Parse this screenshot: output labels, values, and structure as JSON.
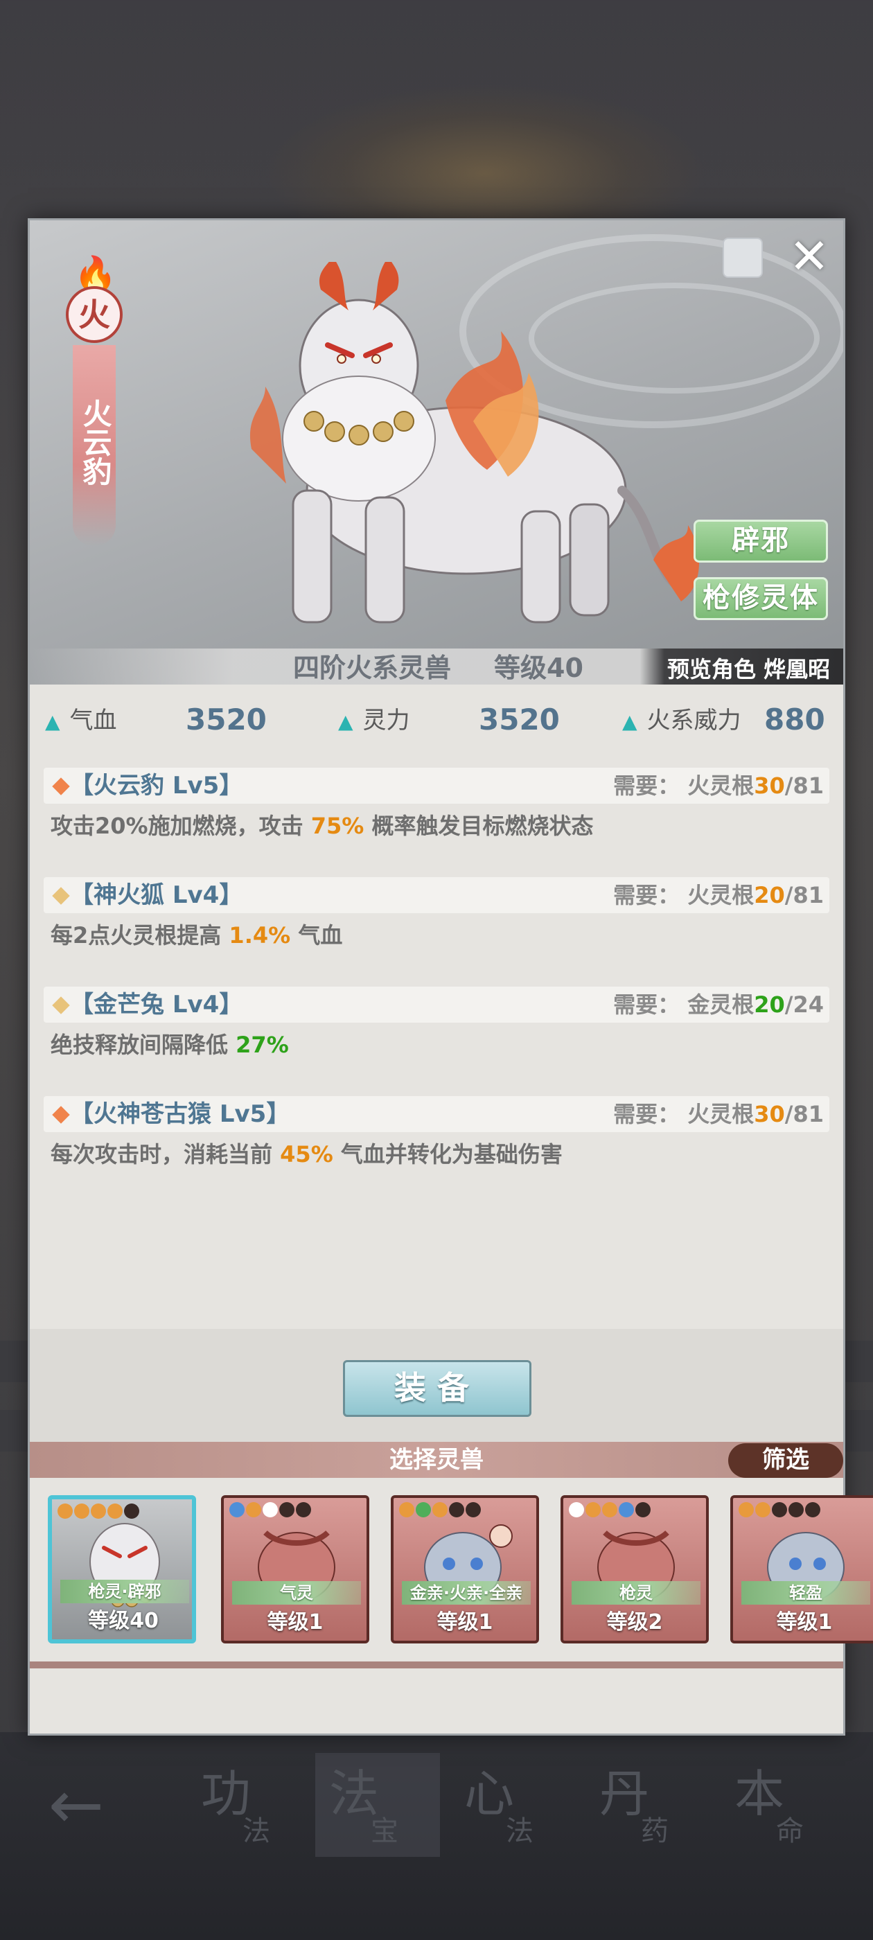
{
  "background": {
    "nav": [
      {
        "big": "功",
        "small": "法"
      },
      {
        "big": "法",
        "small": "宝"
      },
      {
        "big": "心",
        "small": "法"
      },
      {
        "big": "丹",
        "small": "药"
      },
      {
        "big": "本",
        "small": "命"
      }
    ]
  },
  "hero": {
    "element": "火",
    "name": "火云豹",
    "tier": "四阶火系灵兽",
    "level": "等级40",
    "preview": "预览角色 烨凰昭",
    "traits": [
      "辟邪",
      "枪修灵体"
    ]
  },
  "stats": [
    {
      "label": "气血",
      "value": "3520"
    },
    {
      "label": "灵力",
      "value": "3520"
    },
    {
      "label": "火系威力",
      "value": "880"
    }
  ],
  "skills": [
    {
      "name": "【火云豹 Lv5】",
      "diamond_color": "#f0834a",
      "req_label": "需要：",
      "req_root": "火灵根",
      "req_cur": "30",
      "req_max": "/81",
      "req_color": "orange",
      "desc_pre": "攻击20%施加燃烧，攻击 ",
      "desc_hl": "75%",
      "desc_post": " 概率触发目标燃烧状态",
      "hl_color": "orange"
    },
    {
      "name": "【神火狐 Lv4】",
      "diamond_color": "#e8c37a",
      "req_label": "需要：",
      "req_root": "火灵根",
      "req_cur": "20",
      "req_max": "/81",
      "req_color": "orange",
      "desc_pre": "每2点火灵根提高 ",
      "desc_hl": "1.4%",
      "desc_post": " 气血",
      "hl_color": "orange"
    },
    {
      "name": "【金芒兔 Lv4】",
      "diamond_color": "#e8c37a",
      "req_label": "需要：",
      "req_root": "金灵根",
      "req_cur": "20",
      "req_max": "/24",
      "req_color": "green",
      "desc_pre": "绝技释放间隔降低 ",
      "desc_hl": "27%",
      "desc_post": "",
      "hl_color": "green"
    },
    {
      "name": "【火神苍古猿 Lv5】",
      "diamond_color": "#f0834a",
      "req_label": "需要：",
      "req_root": "火灵根",
      "req_cur": "30",
      "req_max": "/81",
      "req_color": "orange",
      "desc_pre": "每次攻击时，消耗当前 ",
      "desc_hl": "45%",
      "desc_post": " 气血并转化为基础伤害",
      "hl_color": "orange"
    }
  ],
  "equip_label": "装备",
  "select_title": "选择灵兽",
  "filter_label": "筛选",
  "cards": [
    {
      "tag": "枪灵·辟邪",
      "level": "等级40",
      "selected": true,
      "paws": [
        "#e89a3c",
        "#e89a3c",
        "#e89a3c",
        "#e89a3c",
        "#3a2a26"
      ]
    },
    {
      "tag": "气灵",
      "level": "等级1",
      "selected": false,
      "paws": [
        "#4f8fd8",
        "#e89a3c",
        "#ffffff",
        "#3a2a26",
        "#3a2a26"
      ]
    },
    {
      "tag": "金亲·火亲·全亲",
      "level": "等级1",
      "selected": false,
      "paws": [
        "#e89a3c",
        "#4fae5a",
        "#e89a3c",
        "#3a2a26",
        "#3a2a26"
      ]
    },
    {
      "tag": "枪灵",
      "level": "等级2",
      "selected": false,
      "paws": [
        "#ffffff",
        "#e89a3c",
        "#e89a3c",
        "#4f8fd8",
        "#3a2a26"
      ]
    },
    {
      "tag": "轻盈",
      "level": "等级1",
      "selected": false,
      "paws": [
        "#e89a3c",
        "#e89a3c",
        "#3a2a26",
        "#3a2a26",
        "#3a2a26"
      ]
    }
  ]
}
